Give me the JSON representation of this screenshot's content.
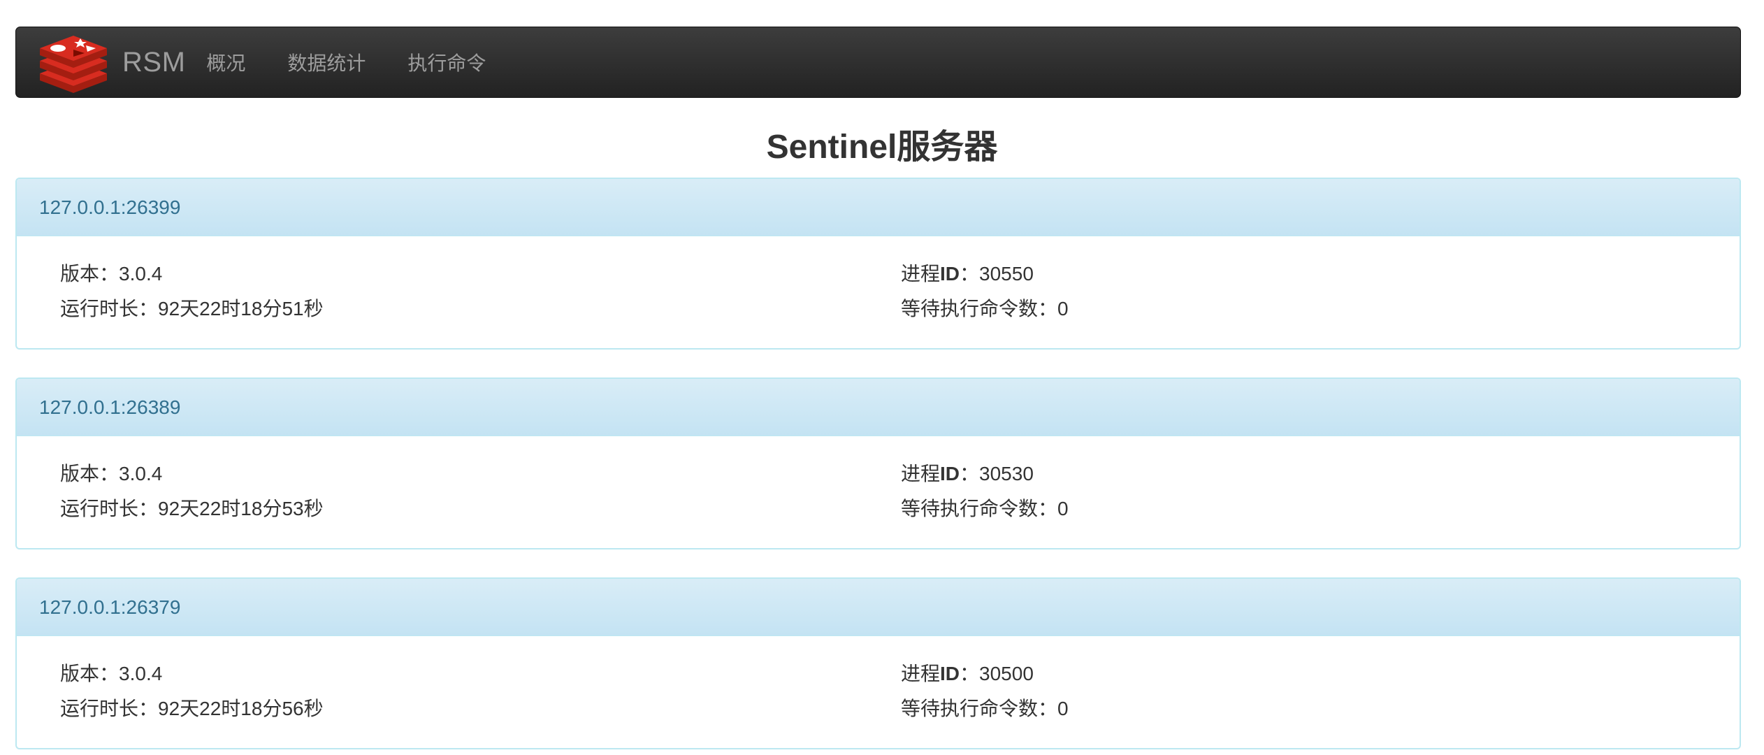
{
  "navbar": {
    "brand": "RSM",
    "logo_icon": "redis-logo-icon",
    "items": [
      "概况",
      "数据统计",
      "执行命令"
    ]
  },
  "page": {
    "title": "Sentinel服务器"
  },
  "labels": {
    "version": "版本：",
    "pid_prefix": "进程",
    "pid_bold": "ID",
    "pid_colon": "：",
    "uptime": "运行时长：",
    "pending": "等待执行命令数："
  },
  "servers": [
    {
      "address": "127.0.0.1:26399",
      "version": "3.0.4",
      "pid": "30550",
      "uptime": "92天22时18分51秒",
      "pending": "0"
    },
    {
      "address": "127.0.0.1:26389",
      "version": "3.0.4",
      "pid": "30530",
      "uptime": "92天22时18分53秒",
      "pending": "0"
    },
    {
      "address": "127.0.0.1:26379",
      "version": "3.0.4",
      "pid": "30500",
      "uptime": "92天22时18分56秒",
      "pending": "0"
    }
  ],
  "colors": {
    "navbar_bg": "#2b2b2b",
    "nav_text": "#9d9d9d",
    "panel_heading_bg": "#d9edf7",
    "panel_border": "#bce8f1",
    "panel_title": "#31708f",
    "logo_red": "#c6302b"
  }
}
